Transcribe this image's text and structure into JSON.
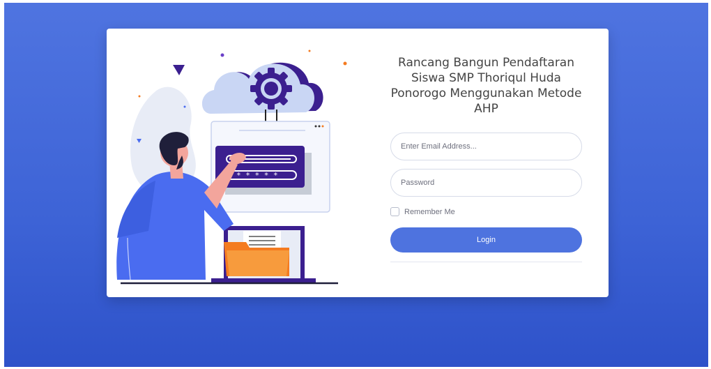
{
  "login": {
    "title": "Rancang Bangun Pendaftaran Siswa SMP Thoriqul Huda Ponorogo Menggunakan Metode AHP",
    "email_placeholder": "Enter Email Address...",
    "password_placeholder": "Password",
    "remember_label": "Remember Me",
    "login_label": "Login"
  },
  "colors": {
    "background": "#4e73df",
    "button": "#4e73df",
    "illustration_purple": "#3b1f8f",
    "illustration_blue": "#4a6cf0",
    "folder_orange": "#f47b20"
  },
  "illustration": {
    "icons": [
      "cloud-icon",
      "gear-icon",
      "password-form-icon",
      "folder-icon",
      "laptop-icon"
    ]
  }
}
